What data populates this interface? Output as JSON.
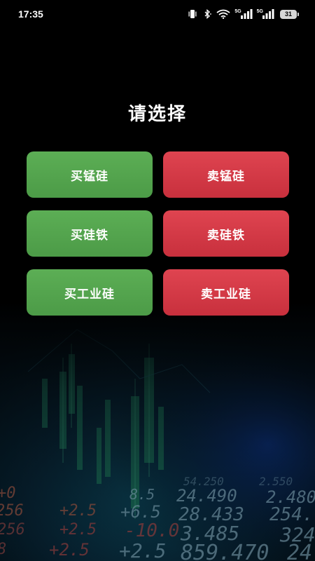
{
  "status_bar": {
    "time": "17:35",
    "signal1_label": "5G",
    "signal2_label": "5G",
    "battery_level": "31",
    "icons": [
      "vibrate-icon",
      "bluetooth-icon",
      "wifi-icon",
      "signal-icon",
      "signal-icon",
      "battery-icon"
    ]
  },
  "page": {
    "title": "请选择"
  },
  "options": {
    "buy_manganese_silicon": "买锰硅",
    "sell_manganese_silicon": "卖锰硅",
    "buy_ferrosilicon": "买硅铁",
    "sell_ferrosilicon": "卖硅铁",
    "buy_industrial_silicon": "买工业硅",
    "sell_industrial_silicon": "卖工业硅"
  },
  "colors": {
    "buy": "#55a64f",
    "sell": "#d63a46",
    "background": "#000000"
  },
  "background_numbers": {
    "row1": [
      "8.5",
      "24.490",
      "2.480",
      "54.250",
      "2.550"
    ],
    "row2": [
      "+2.5",
      "+6.5",
      "28.433",
      "254.",
      "256"
    ],
    "row3": [
      "+2.5",
      "-10.0",
      "3.485",
      "324"
    ],
    "row4": [
      "+2.5",
      "+2.5",
      "859.470",
      "24"
    ]
  }
}
